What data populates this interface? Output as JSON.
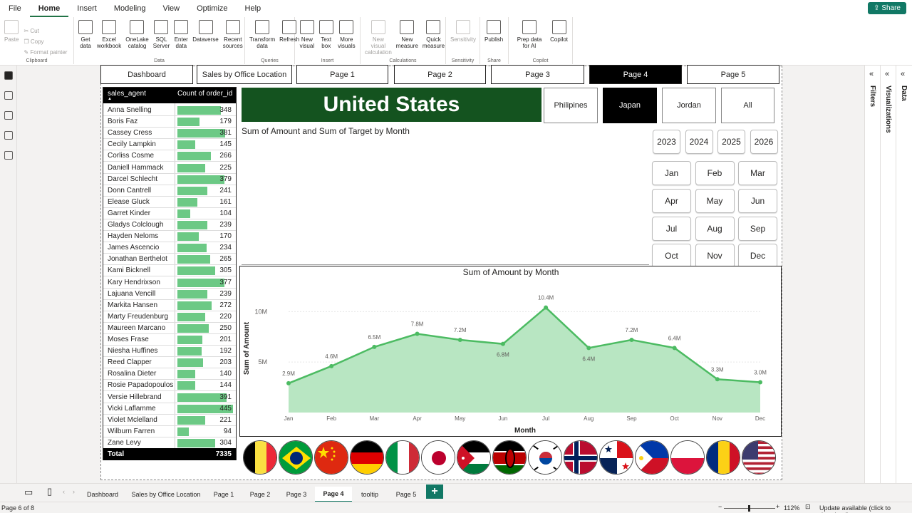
{
  "menu": [
    "File",
    "Home",
    "Insert",
    "Modeling",
    "View",
    "Optimize",
    "Help"
  ],
  "active_menu": "Home",
  "share_label": "Share",
  "ribbon": {
    "clipboard": {
      "paste": "Paste",
      "cut": "Cut",
      "copy": "Copy",
      "format": "Format painter",
      "label": "Clipboard"
    },
    "data": {
      "buttons": [
        "Get data",
        "Excel workbook",
        "OneLake catalog",
        "SQL Server",
        "Enter data",
        "Dataverse",
        "Recent sources"
      ],
      "label": "Data"
    },
    "queries": {
      "buttons": [
        "Transform data",
        "Refresh"
      ],
      "label": "Queries"
    },
    "insert": {
      "buttons": [
        "New visual",
        "Text box",
        "More visuals"
      ],
      "label": "Insert"
    },
    "calculations": {
      "buttons": [
        "New visual calculation",
        "New measure",
        "Quick measure"
      ],
      "label": "Calculations"
    },
    "sensitivity": {
      "buttons": [
        "Sensitivity"
      ],
      "label": "Sensitivity"
    },
    "share": {
      "buttons": [
        "Publish"
      ],
      "label": "Share"
    },
    "copilot": {
      "buttons": [
        "Prep data for AI",
        "Copilot"
      ],
      "label": "Copilot"
    }
  },
  "nav_buttons": [
    "Dashboard",
    "Sales by Office Location",
    "Page 1",
    "Page 2",
    "Page 3",
    "Page 4",
    "Page 5"
  ],
  "selected_nav": "Page 4",
  "table": {
    "col1": "sales_agent",
    "col2": "Count of order_id",
    "rows": [
      {
        "name": "Anna Snelling",
        "value": 348
      },
      {
        "name": "Boris Faz",
        "value": 179
      },
      {
        "name": "Cassey Cress",
        "value": 381
      },
      {
        "name": "Cecily Lampkin",
        "value": 145
      },
      {
        "name": "Corliss Cosme",
        "value": 266
      },
      {
        "name": "Daniell Hammack",
        "value": 225
      },
      {
        "name": "Darcel Schlecht",
        "value": 379
      },
      {
        "name": "Donn Cantrell",
        "value": 241
      },
      {
        "name": "Elease Gluck",
        "value": 161
      },
      {
        "name": "Garret Kinder",
        "value": 104
      },
      {
        "name": "Gladys Colclough",
        "value": 239
      },
      {
        "name": "Hayden Neloms",
        "value": 170
      },
      {
        "name": "James Ascencio",
        "value": 234
      },
      {
        "name": "Jonathan Berthelot",
        "value": 265
      },
      {
        "name": "Kami Bicknell",
        "value": 305
      },
      {
        "name": "Kary Hendrixson",
        "value": 377
      },
      {
        "name": "Lajuana Vencill",
        "value": 239
      },
      {
        "name": "Markita Hansen",
        "value": 272
      },
      {
        "name": "Marty Freudenburg",
        "value": 220
      },
      {
        "name": "Maureen Marcano",
        "value": 250
      },
      {
        "name": "Moses Frase",
        "value": 201
      },
      {
        "name": "Niesha Huffines",
        "value": 192
      },
      {
        "name": "Reed Clapper",
        "value": 203
      },
      {
        "name": "Rosalina Dieter",
        "value": 140
      },
      {
        "name": "Rosie Papadopoulos",
        "value": 144
      },
      {
        "name": "Versie Hillebrand",
        "value": 391
      },
      {
        "name": "Vicki Laflamme",
        "value": 445
      },
      {
        "name": "Violet Mclelland",
        "value": 221
      },
      {
        "name": "Wilburn Farren",
        "value": 94
      },
      {
        "name": "Zane Levy",
        "value": 304
      }
    ],
    "total_label": "Total",
    "total_value": "7335"
  },
  "banner_title": "United States",
  "country_buttons": [
    "Philipines",
    "Japan",
    "Jordan",
    "All"
  ],
  "selected_country": "Japan",
  "chart1_title": "Sum of Amount and Sum of Target by Month",
  "years": [
    "2023",
    "2024",
    "2025",
    "2026"
  ],
  "months": [
    "Jan",
    "Feb",
    "Mar",
    "Apr",
    "May",
    "Jun",
    "Jul",
    "Aug",
    "Sep",
    "Oct",
    "Nov",
    "Dec"
  ],
  "chart_data": {
    "type": "area",
    "title": "Sum of Amount by Month",
    "xlabel": "Month",
    "ylabel": "Sum of Amount",
    "categories": [
      "Jan",
      "Feb",
      "Mar",
      "Apr",
      "May",
      "Jun",
      "Jul",
      "Aug",
      "Sep",
      "Oct",
      "Nov",
      "Dec"
    ],
    "values": [
      2.9,
      4.6,
      6.5,
      7.8,
      7.2,
      6.8,
      10.4,
      6.4,
      7.2,
      6.4,
      3.3,
      3.0
    ],
    "labels": [
      "2.9M",
      "4.6M",
      "6.5M",
      "7.8M",
      "7.2M",
      "6.8M",
      "10.4M",
      "6.4M",
      "7.2M",
      "6.4M",
      "3.3M",
      "3.0M"
    ],
    "yticks": [
      {
        "value": 5,
        "label": "5M"
      },
      {
        "value": 10,
        "label": "10M"
      }
    ],
    "ylim": [
      0,
      12
    ],
    "color": "#4cbb62",
    "fill": "#b8e6c2"
  },
  "flags": [
    "belgium",
    "brazil",
    "china",
    "germany",
    "italy",
    "japan",
    "jordan",
    "kenya",
    "south-korea",
    "norway",
    "panama",
    "philippines",
    "poland",
    "romania",
    "united-states"
  ],
  "page_tabs": [
    "Dashboard",
    "Sales by Office Location",
    "Page 1",
    "Page 2",
    "Page 3",
    "Page 4",
    "tooltip",
    "Page 5"
  ],
  "selected_tab": "Page 4",
  "right_panes": [
    "Filters",
    "Visualizations",
    "Data"
  ],
  "status": {
    "page": "Page 6 of 8",
    "zoom": "112%",
    "update": "Update available (click to download)"
  }
}
